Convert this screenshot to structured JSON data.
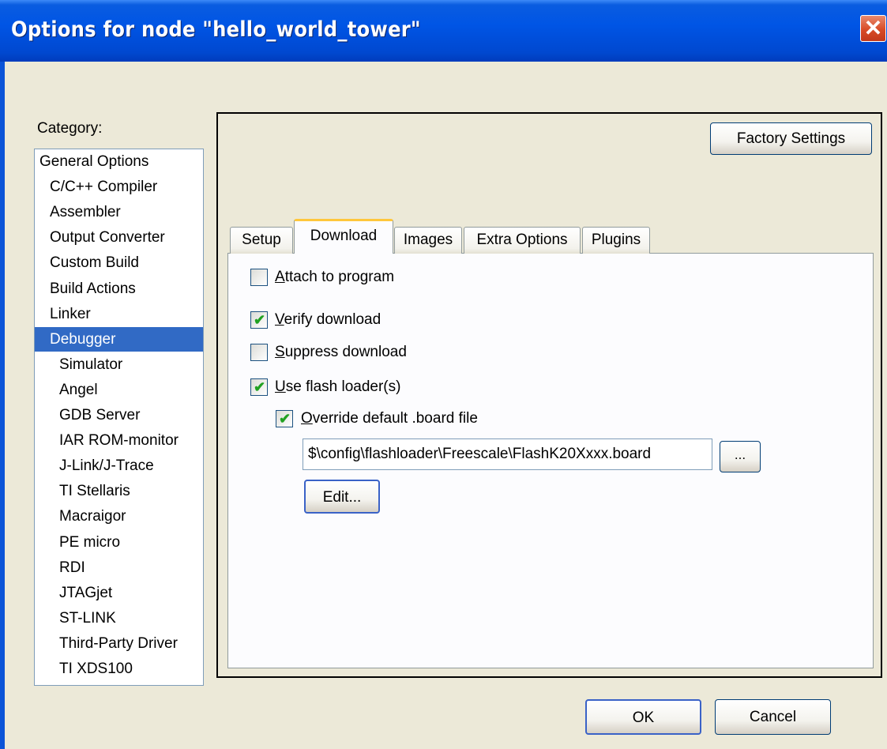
{
  "window": {
    "title": "Options for node \"hello_world_tower\"",
    "close_glyph": "✕"
  },
  "category": {
    "label": "Category:",
    "items": [
      {
        "label": "General Options",
        "level": 0,
        "selected": false
      },
      {
        "label": "C/C++ Compiler",
        "level": 1,
        "selected": false
      },
      {
        "label": "Assembler",
        "level": 1,
        "selected": false
      },
      {
        "label": "Output Converter",
        "level": 1,
        "selected": false
      },
      {
        "label": "Custom Build",
        "level": 1,
        "selected": false
      },
      {
        "label": "Build Actions",
        "level": 1,
        "selected": false
      },
      {
        "label": "Linker",
        "level": 1,
        "selected": false
      },
      {
        "label": "Debugger",
        "level": 1,
        "selected": true
      },
      {
        "label": "Simulator",
        "level": 2,
        "selected": false
      },
      {
        "label": "Angel",
        "level": 2,
        "selected": false
      },
      {
        "label": "GDB Server",
        "level": 2,
        "selected": false
      },
      {
        "label": "IAR ROM-monitor",
        "level": 2,
        "selected": false
      },
      {
        "label": "J-Link/J-Trace",
        "level": 2,
        "selected": false
      },
      {
        "label": "TI Stellaris",
        "level": 2,
        "selected": false
      },
      {
        "label": "Macraigor",
        "level": 2,
        "selected": false
      },
      {
        "label": "PE micro",
        "level": 2,
        "selected": false
      },
      {
        "label": "RDI",
        "level": 2,
        "selected": false
      },
      {
        "label": "JTAGjet",
        "level": 2,
        "selected": false
      },
      {
        "label": "ST-LINK",
        "level": 2,
        "selected": false
      },
      {
        "label": "Third-Party Driver",
        "level": 2,
        "selected": false
      },
      {
        "label": "TI XDS100",
        "level": 2,
        "selected": false
      }
    ]
  },
  "factory_settings_label": "Factory Settings",
  "tabs": [
    {
      "label": "Setup",
      "active": false
    },
    {
      "label": "Download",
      "active": true
    },
    {
      "label": "Images",
      "active": false
    },
    {
      "label": "Extra Options",
      "active": false
    },
    {
      "label": "Plugins",
      "active": false
    }
  ],
  "download": {
    "attach": {
      "mnemonic": "A",
      "rest": "ttach to program",
      "checked": false
    },
    "verify": {
      "mnemonic": "V",
      "rest": "erify download",
      "checked": true
    },
    "suppress": {
      "mnemonic": "S",
      "rest": "uppress download",
      "checked": false
    },
    "flash": {
      "mnemonic": "U",
      "rest": "se flash loader(s)",
      "checked": true
    },
    "override": {
      "mnemonic": "O",
      "rest": "verride default .board file",
      "checked": true
    },
    "board_path": "$\\config\\flashloader\\Freescale\\FlashK20Xxxx.board",
    "browse_label": "...",
    "edit_label": "Edit..."
  },
  "buttons": {
    "ok": "OK",
    "cancel": "Cancel"
  }
}
